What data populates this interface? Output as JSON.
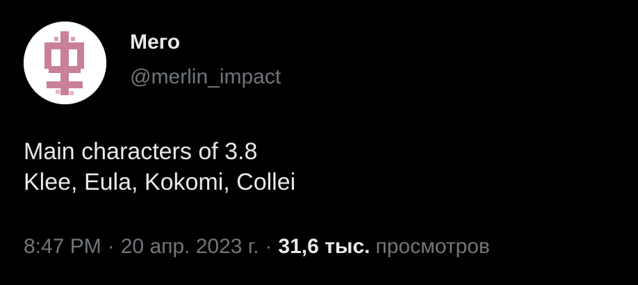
{
  "author": {
    "name": "Мего",
    "handle": "@merlin_impact",
    "avatar_icon": "pink-glyph-avatar-icon"
  },
  "tweet": {
    "lines": [
      "Main characters of 3.8",
      "Klee, Eula, Kokomi, Collei"
    ]
  },
  "meta": {
    "time": "8:47 PM",
    "separator": "·",
    "date": "20 апр. 2023 г.",
    "views_count": "31,6 тыс.",
    "views_label": "просмотров"
  },
  "colors": {
    "background": "#000000",
    "primary_text": "#e7e9ea",
    "secondary_text": "#71767b",
    "avatar_glyph": "#c9809a"
  }
}
